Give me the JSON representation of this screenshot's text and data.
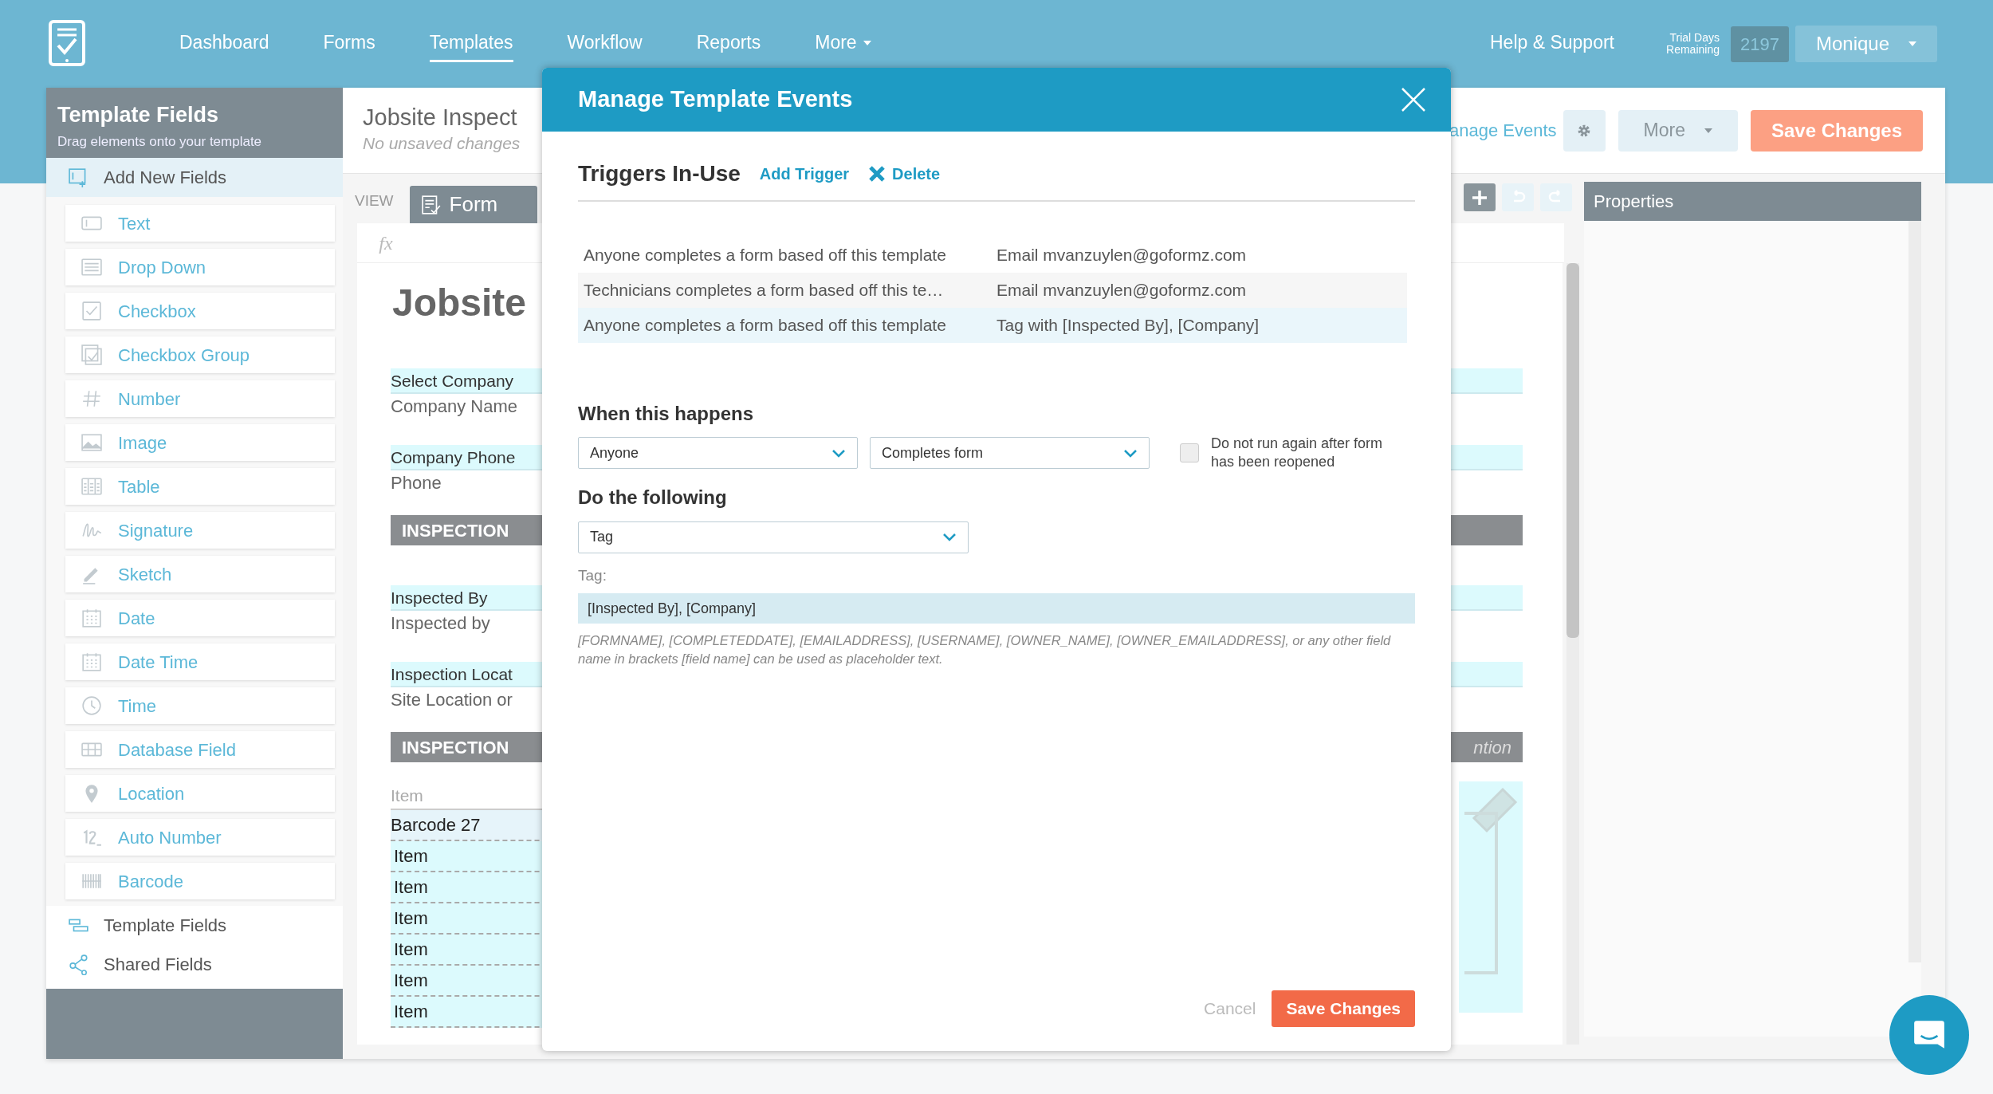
{
  "nav": {
    "items": [
      {
        "label": "Dashboard",
        "selected": false
      },
      {
        "label": "Forms",
        "selected": false
      },
      {
        "label": "Templates",
        "selected": true
      },
      {
        "label": "Workflow",
        "selected": false
      },
      {
        "label": "Reports",
        "selected": false
      }
    ],
    "more": "More",
    "help": "Help & Support",
    "trial_label": "Trial Days Remaining",
    "trial_days": "2197",
    "user": "Monique"
  },
  "sidebar": {
    "title": "Template Fields",
    "subtitle": "Drag elements onto your template",
    "sections": [
      {
        "label": "Add New Fields",
        "kind": "add",
        "expanded": true,
        "fields": [
          {
            "label": "Text",
            "kind": "text"
          },
          {
            "label": "Drop Down",
            "kind": "dropdown"
          },
          {
            "label": "Checkbox",
            "kind": "checkbox"
          },
          {
            "label": "Checkbox Group",
            "kind": "checkgroup"
          },
          {
            "label": "Number",
            "kind": "number"
          },
          {
            "label": "Image",
            "kind": "image"
          },
          {
            "label": "Table",
            "kind": "table"
          },
          {
            "label": "Signature",
            "kind": "signature"
          },
          {
            "label": "Sketch",
            "kind": "sketch"
          },
          {
            "label": "Date",
            "kind": "date"
          },
          {
            "label": "Date Time",
            "kind": "date"
          },
          {
            "label": "Time",
            "kind": "time"
          },
          {
            "label": "Database Field",
            "kind": "database"
          },
          {
            "label": "Location",
            "kind": "location"
          },
          {
            "label": "Auto Number",
            "kind": "autonumber"
          },
          {
            "label": "Barcode",
            "kind": "barcode"
          }
        ]
      },
      {
        "label": "Template Fields",
        "kind": "template",
        "expanded": false
      },
      {
        "label": "Shared Fields",
        "kind": "shared",
        "expanded": false
      }
    ]
  },
  "editor": {
    "title": "Jobsite Inspect",
    "status": "No unsaved changes",
    "manage_events": "anage Events",
    "more": "More",
    "save": "Save Changes",
    "view_label": "VIEW",
    "view_tab": "Form",
    "formula": "fx",
    "canvas": {
      "heading": "Jobsite",
      "elements": [
        {
          "kind": "field",
          "label": "Select Company",
          "value": "Company Name"
        },
        {
          "kind": "field",
          "label": "Company Phone",
          "value": "Phone"
        },
        {
          "kind": "section",
          "label": "INSPECTION"
        },
        {
          "kind": "field",
          "label": "Inspected By",
          "value": "Inspected by"
        },
        {
          "kind": "field",
          "label": "Inspection Locat",
          "value": "Site Location or"
        },
        {
          "kind": "section",
          "label": "INSPECTION",
          "note": "ntion"
        },
        {
          "kind": "table",
          "column": "Item",
          "rows": [
            "Barcode 27",
            "Item",
            "Item",
            "Item",
            "Item",
            "Item",
            "Item"
          ]
        }
      ]
    }
  },
  "properties": {
    "title": "Properties"
  },
  "modal": {
    "title": "Manage Template Events",
    "triggers_title": "Triggers In-Use",
    "add_trigger": "Add Trigger",
    "delete": "Delete",
    "triggers": [
      {
        "condition": "Anyone completes a form based off this template",
        "action": "Email mvanzuylen@goformz.com",
        "selected": false
      },
      {
        "condition": "Technicians completes a form based off this te…",
        "action": "Email mvanzuylen@goformz.com",
        "selected": false
      },
      {
        "condition": "Anyone completes a form based off this template",
        "action": "Tag with [Inspected By], [Company]",
        "selected": true
      }
    ],
    "when_title": "When this happens",
    "who": "Anyone",
    "event": "Completes form",
    "no_rerun": {
      "label": "Do not run again after form has been reopened",
      "checked": false
    },
    "do_title": "Do the following",
    "action": "Tag",
    "tag_label": "Tag:",
    "tag_value": "[Inspected By], [Company]",
    "help": "[FORMNAME], [COMPLETEDDATE], [EMAILADDRESS], [USERNAME], [OWNER_NAME], [OWNER_EMAILADDRESS], or any other field name in brackets [field name] can be used as placeholder text.",
    "cancel": "Cancel",
    "save": "Save Changes"
  }
}
